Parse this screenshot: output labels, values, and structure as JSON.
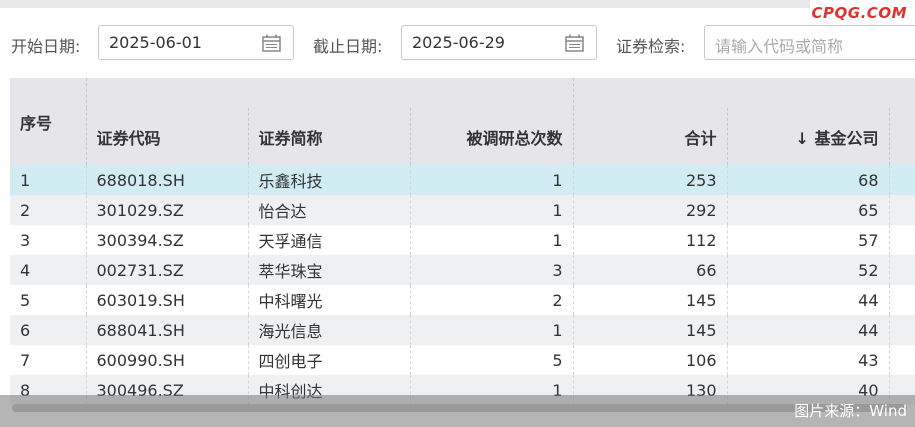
{
  "watermark": "CPQG.COM",
  "filters": {
    "start_label": "开始日期:",
    "start_value": "2025-06-01",
    "end_label": "截止日期:",
    "end_value": "2025-06-29",
    "search_label": "证券检索:",
    "search_placeholder": "请输入代码或简称"
  },
  "table": {
    "headers": {
      "seq": "序号",
      "code": "证券代码",
      "name": "证券简称",
      "count": "被调研总次数",
      "total": "合计",
      "fund": "↓ 基金公司"
    },
    "rows": [
      {
        "seq": "1",
        "code": "688018.SH",
        "name": "乐鑫科技",
        "count": "1",
        "total": "253",
        "fund": "68"
      },
      {
        "seq": "2",
        "code": "301029.SZ",
        "name": "怡合达",
        "count": "1",
        "total": "292",
        "fund": "65"
      },
      {
        "seq": "3",
        "code": "300394.SZ",
        "name": "天孚通信",
        "count": "1",
        "total": "112",
        "fund": "57"
      },
      {
        "seq": "4",
        "code": "002731.SZ",
        "name": "萃华珠宝",
        "count": "3",
        "total": "66",
        "fund": "52"
      },
      {
        "seq": "5",
        "code": "603019.SH",
        "name": "中科曙光",
        "count": "2",
        "total": "145",
        "fund": "44"
      },
      {
        "seq": "6",
        "code": "688041.SH",
        "name": "海光信息",
        "count": "1",
        "total": "145",
        "fund": "44"
      },
      {
        "seq": "7",
        "code": "600990.SH",
        "name": "四创电子",
        "count": "5",
        "total": "106",
        "fund": "43"
      },
      {
        "seq": "8",
        "code": "300496.SZ",
        "name": "中科创达",
        "count": "1",
        "total": "130",
        "fund": "40"
      }
    ]
  },
  "source": "图片来源：Wind"
}
